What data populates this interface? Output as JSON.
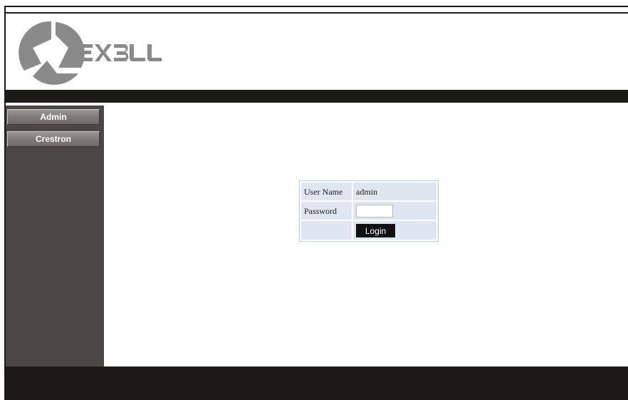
{
  "brand": {
    "name": "EXELL",
    "logo_icon": "exell-logo-icon"
  },
  "sidebar": {
    "items": [
      {
        "label": "Admin"
      },
      {
        "label": "Crestron"
      }
    ]
  },
  "login": {
    "user_label": "User Name",
    "user_value": "admin",
    "password_label": "Password",
    "password_value": "",
    "button_label": "Login"
  },
  "colors": {
    "header_bar": "#1c1a17",
    "sidebar_bg": "#4a4744",
    "table_cell": "#dde6f1",
    "logo_gray": "#8a8a8a"
  }
}
